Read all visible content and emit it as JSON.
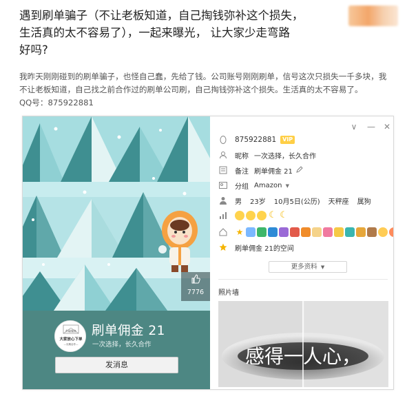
{
  "post": {
    "title_lines": [
      "遇到刷单骗子（不让老板知道，自己掏钱弥补这个损失，",
      "生活真的太不容易了），一起来曝光， 让大家少走弯路",
      "好吗?"
    ],
    "body_lines": [
      "我昨天刚刚碰到的刷单骗子，也怪自己蠢，先给了钱。公司账号刚刚刷单，信号这次只损失一千多块，我",
      "不让老板知道，自己找之前合作过的刷单公司刷，自己掏钱弥补这个损失。生活真的太不容易了。",
      "QQ号：875922881"
    ]
  },
  "profile_card": {
    "like_count": "7776",
    "nickname": "刷单佣金 21",
    "signature": "一次选择，长久合作",
    "send_message_label": "发消息",
    "avatar_text": [
      "升级服务",
      "大家放心下单",
      "—长期合作—"
    ],
    "window_controls": [
      "∨",
      "—",
      "✕"
    ],
    "qq_number": "875922881",
    "vip_badge": "VIP",
    "nickname_label": "昵称",
    "nickname_value": "一次选择，长久合作",
    "remark_label": "备注",
    "remark_value": "刷单佣金 21",
    "group_label": "分组",
    "group_value": "Amazon",
    "gender": "男",
    "age": "23岁",
    "birthday": "10月5日(公历)",
    "zodiac": "天秤座",
    "chinese_zodiac": "属狗",
    "space_link": "刷单佣金 21的空间",
    "more_info_label": "更多资料",
    "photo_wall_title": "照片墙",
    "photo_text": "感得一人心，"
  },
  "colors": {
    "sky": "#b5e3e6",
    "tree_dark": "#3f8f91",
    "tree_light": "#8fd0d3",
    "tree_white": "#e3f4f4",
    "profile_bg": "#4d8783",
    "link_blue": "#2a6fbf"
  },
  "icons": {
    "qq": "penguin-icon",
    "nickname": "person-card-icon",
    "remark": "list-icon",
    "group": "group-card-icon",
    "personal": "person-icon",
    "level": "signal-bars-icon",
    "badges": "house-star-icon",
    "space": "star-space-icon"
  }
}
